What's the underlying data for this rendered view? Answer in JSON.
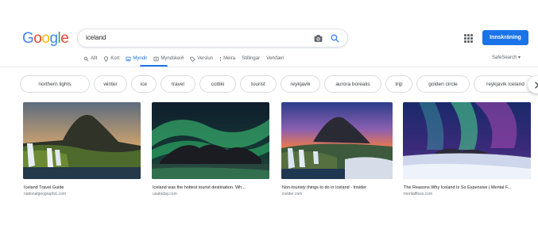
{
  "logo": {
    "letters": [
      "G",
      "o",
      "o",
      "g",
      "l",
      "e"
    ],
    "colors": [
      "#4285f4",
      "#ea4335",
      "#fbbc05",
      "#4285f4",
      "#34a853",
      "#ea4335"
    ]
  },
  "search": {
    "value": "iceland"
  },
  "header": {
    "signin_label": "Innskráning"
  },
  "tabs": [
    {
      "label": "Allt",
      "icon": "search-icon"
    },
    {
      "label": "Kort",
      "icon": "map-pin-icon"
    },
    {
      "label": "Myndir",
      "icon": "image-icon",
      "active": true
    },
    {
      "label": "Myndskeið",
      "icon": "video-icon"
    },
    {
      "label": "Verslun",
      "icon": "tag-icon"
    },
    {
      "label": "Meira",
      "icon": "more-icon"
    },
    {
      "label": "Stillingar"
    },
    {
      "label": "Verkfæri"
    }
  ],
  "safesearch": {
    "label": "SafeSearch ▾"
  },
  "chips": [
    "northern lights",
    "winter",
    "ice",
    "travel",
    "cottiki",
    "tourist",
    "reykjavik",
    "aurora borealis",
    "trip",
    "golden circle",
    "reykjavik iceland"
  ],
  "results": [
    {
      "title": "Iceland Travel Guide",
      "source": "nationalgeographic.com"
    },
    {
      "title": "Iceland was the hottest tourist destination. Wh...",
      "source": "usatoday.com"
    },
    {
      "title": "Non-touristy things to do in Iceland - Insider",
      "source": "insider.com"
    },
    {
      "title": "The Reasons Why Iceland Is So Expensive | Mental F...",
      "source": "mentalfloss.com"
    }
  ],
  "colors": {
    "accent": "#1a73e8"
  }
}
